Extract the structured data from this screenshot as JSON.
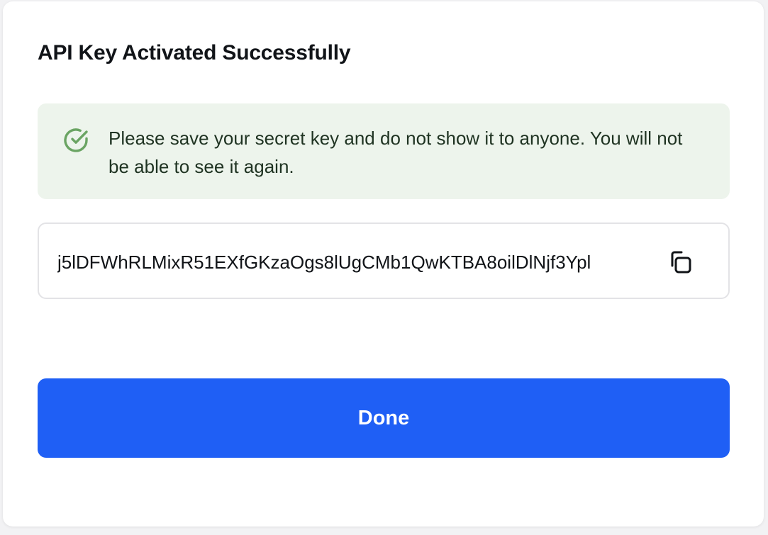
{
  "dialog": {
    "title": "API Key Activated Successfully",
    "notice": {
      "icon": "check-circle-icon",
      "color": "#6aa463",
      "text": "Please save your secret key and do not show it to anyone. You will not be able to see it again."
    },
    "key": {
      "value": "j5lDFWhRLMixR51EXfGKzaOgs8lUgCMb1QwKTBA8oilDlNjf3Ypl",
      "copy_icon": "copy-icon"
    },
    "done_label": "Done",
    "accent": "#1f5ff5"
  }
}
